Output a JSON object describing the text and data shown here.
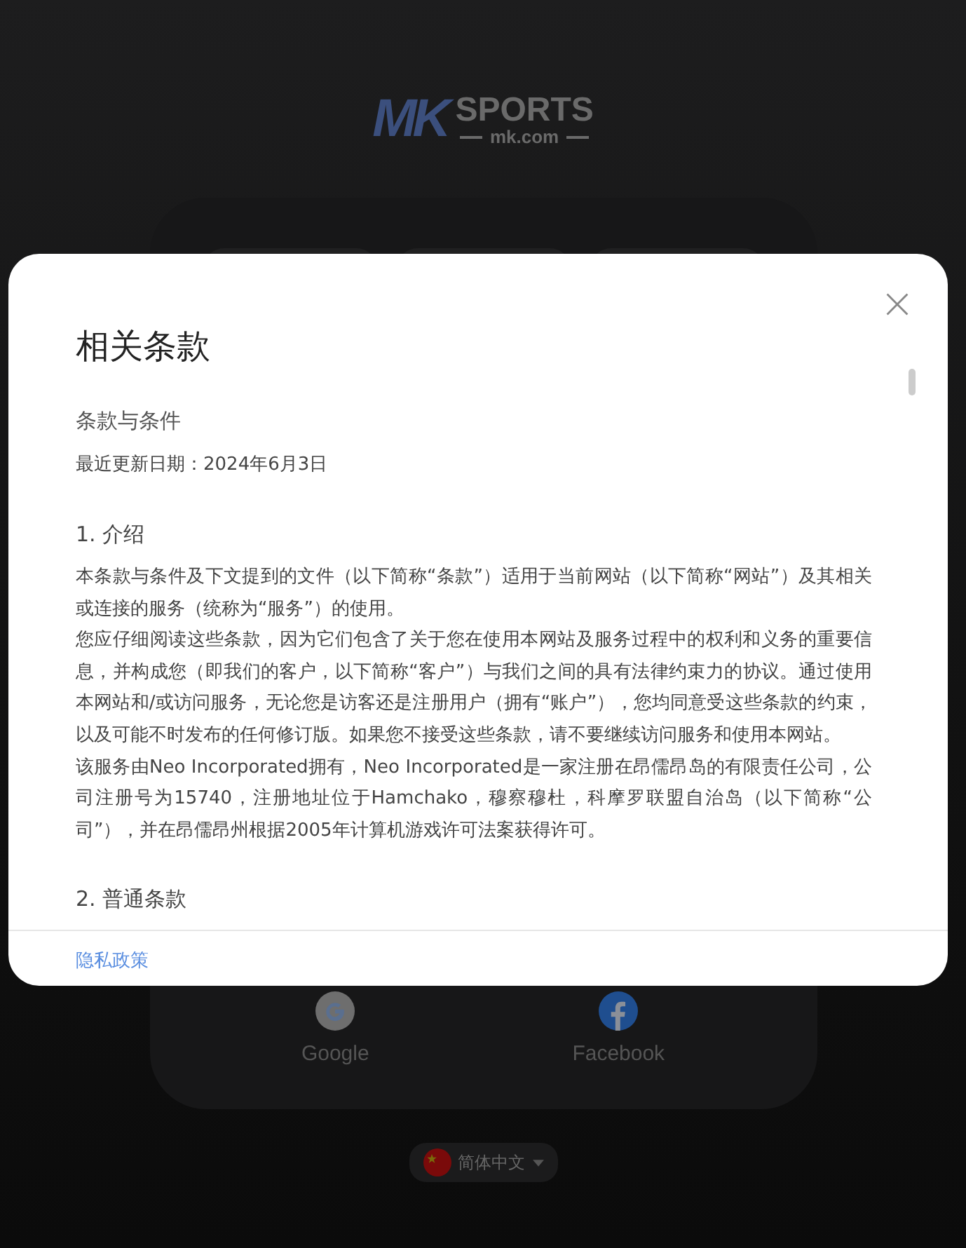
{
  "logo": {
    "mark": "MK",
    "name": "SPORTS",
    "domain": "mk.com"
  },
  "social_logins": [
    {
      "label": "Google",
      "kind": "google"
    },
    {
      "label": "Facebook",
      "kind": "facebook"
    }
  ],
  "language": {
    "label": "简体中文"
  },
  "dialog": {
    "title": "相关条款",
    "subtitle": "条款与条件",
    "updated": "最近更新日期：2024年6月3日",
    "sections": [
      {
        "heading": "1. 介绍",
        "paragraphs": [
          "本条款与条件及下文提到的文件（以下简称“条款”）适用于当前网站（以下简称“网站”）及其相关或连接的服务（统称为“服务”）的使用。",
          "您应仔细阅读这些条款，因为它们包含了关于您在使用本网站及服务过程中的权利和义务的重要信息，并构成您（即我们的客户，以下简称“客户”）与我们之间的具有法律约束力的协议。通过使用本网站和/或访问服务，无论您是访客还是注册用户（拥有“账户”），您均同意受这些条款的约束，以及可能不时发布的任何修订版。如果您不接受这些条款，请不要继续访问服务和使用本网站。",
          "该服务由Neo Incorporated拥有，Neo Incorporated是一家注册在昂儒昂岛的有限责任公司，公司注册号为15740，注册地址位于Hamchako，穆察穆杜，科摩罗联盟自治岛（以下简称“公司”），并在昂儒昂州根据2005年计算机游戏许可法案获得许可。"
        ]
      },
      {
        "heading": "2. 普通条款"
      }
    ],
    "footer_link": "隐私政策"
  }
}
